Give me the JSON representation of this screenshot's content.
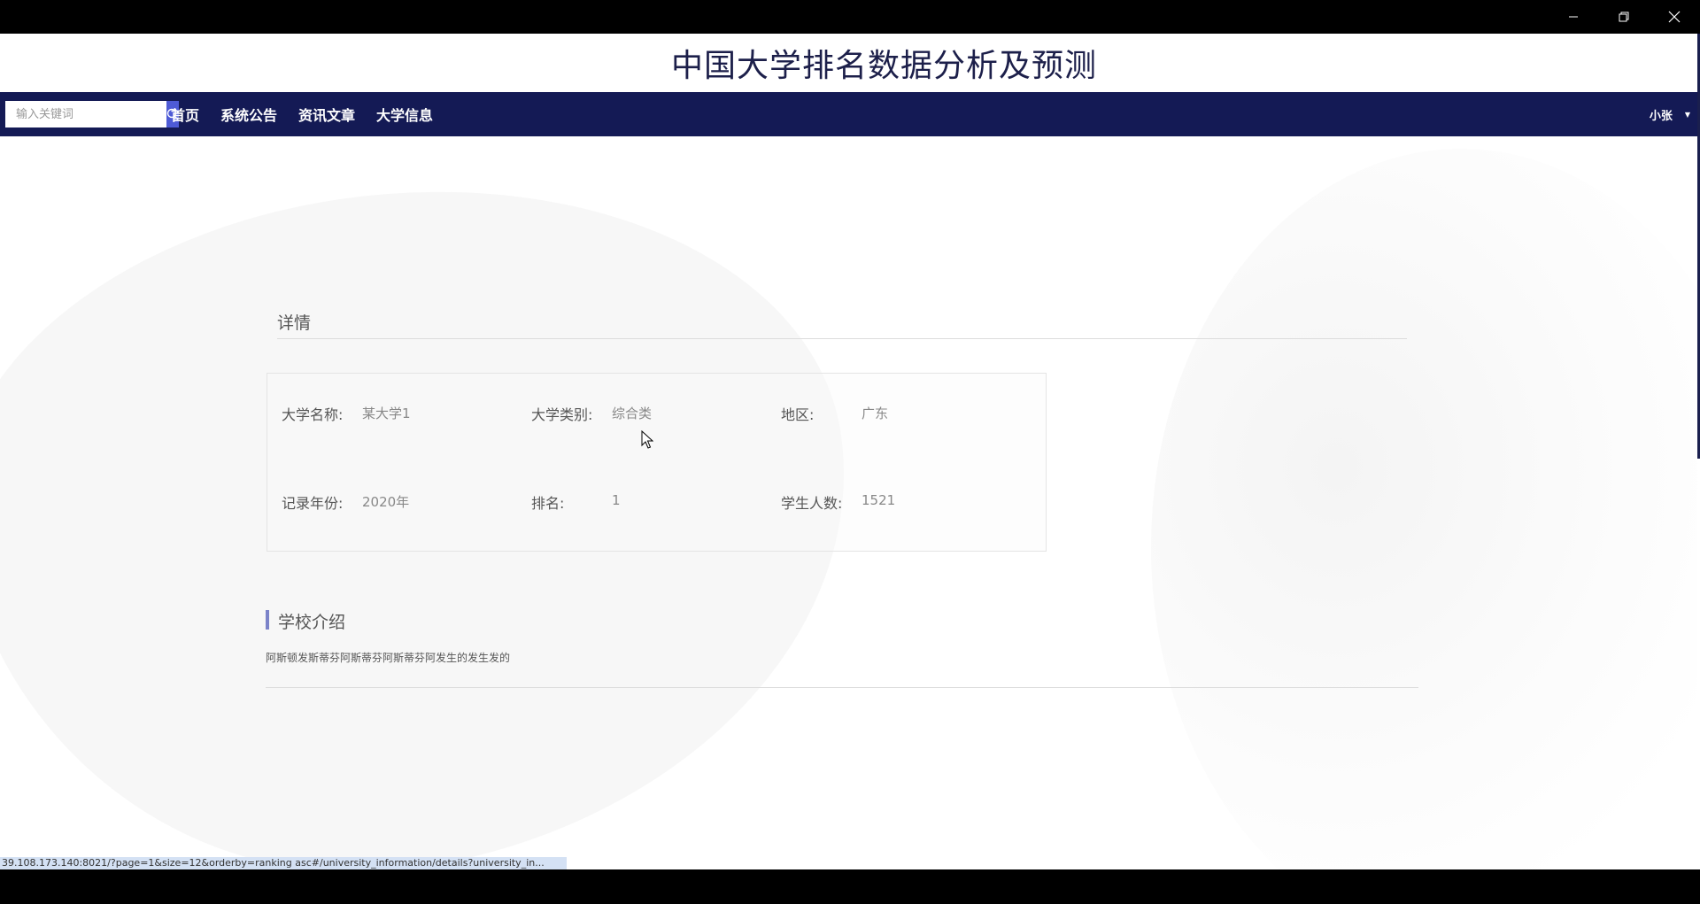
{
  "site": {
    "title": "中国大学排名数据分析及预测"
  },
  "search": {
    "placeholder": "输入关键词"
  },
  "nav": {
    "items": [
      {
        "label": "首页"
      },
      {
        "label": "系统公告"
      },
      {
        "label": "资讯文章"
      },
      {
        "label": "大学信息"
      }
    ],
    "user": "小张"
  },
  "detail": {
    "heading": "详情",
    "fields": {
      "name": {
        "label": "大学名称:",
        "value": "某大学1"
      },
      "category": {
        "label": "大学类别:",
        "value": "综合类"
      },
      "region": {
        "label": "地区:",
        "value": "广东"
      },
      "year": {
        "label": "记录年份:",
        "value": "2020年"
      },
      "ranking": {
        "label": "排名:",
        "value": "1"
      },
      "students": {
        "label": "学生人数:",
        "value": "1521"
      }
    }
  },
  "intro": {
    "title": "学校介绍",
    "text": "阿斯顿发斯蒂芬阿斯蒂芬阿斯蒂芬阿发生的发生发的"
  },
  "status": {
    "url": "39.108.173.140:8021/?page=1&size=12&orderby=ranking asc#/university_information/details?university_in..."
  },
  "colors": {
    "navbar": "#141a55",
    "search_button": "#4e5bd6",
    "section_accent": "#7b83c9"
  }
}
